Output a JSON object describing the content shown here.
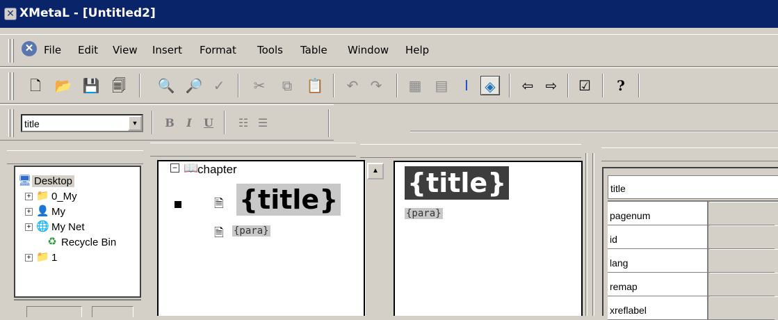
{
  "window": {
    "title": "XMetaL - [Untitled2]",
    "app_icon": "xmetal-logo-icon"
  },
  "menu": {
    "items": [
      "File",
      "Edit",
      "View",
      "Insert",
      "Format",
      "Tools",
      "Table",
      "Window",
      "Help"
    ]
  },
  "toolbar": {
    "buttons": [
      {
        "name": "new-document-icon",
        "glyph": "🗋"
      },
      {
        "name": "open-folder-icon",
        "glyph": "📂"
      },
      {
        "name": "save-icon",
        "glyph": "💾"
      },
      {
        "name": "save-all-icon",
        "glyph": "🗐"
      },
      {
        "name": "find-icon",
        "glyph": "🔍"
      },
      {
        "name": "find-replace-icon",
        "glyph": "🔎"
      },
      {
        "name": "spellcheck-icon",
        "glyph": "✓"
      },
      {
        "name": "cut-icon",
        "glyph": "✂"
      },
      {
        "name": "copy-icon",
        "glyph": "⧉"
      },
      {
        "name": "paste-icon",
        "glyph": "📋"
      },
      {
        "name": "undo-icon",
        "glyph": "↶"
      },
      {
        "name": "redo-icon",
        "glyph": "↷"
      },
      {
        "name": "insert-image-icon",
        "glyph": "▦"
      },
      {
        "name": "insert-table-icon",
        "glyph": "▤"
      },
      {
        "name": "text-cursor-icon",
        "glyph": "I"
      },
      {
        "name": "tags-on-view-icon",
        "glyph": "◈"
      },
      {
        "name": "back-arrow-icon",
        "glyph": "⇦"
      },
      {
        "name": "forward-arrow-icon",
        "glyph": "⇨"
      },
      {
        "name": "validate-icon",
        "glyph": "☑"
      },
      {
        "name": "help-icon",
        "glyph": "?"
      }
    ]
  },
  "format_bar": {
    "style_value": "title",
    "buttons": [
      {
        "name": "bold-icon",
        "glyph": "B"
      },
      {
        "name": "italic-icon",
        "glyph": "I"
      },
      {
        "name": "underline-icon",
        "glyph": "U"
      },
      {
        "name": "numbered-list-icon",
        "glyph": "☷"
      },
      {
        "name": "bulleted-list-icon",
        "glyph": "☰"
      }
    ]
  },
  "explorer": {
    "items": [
      {
        "label": "Desktop",
        "icon": "desktop-icon",
        "glyph": "🖥",
        "expandable": false
      },
      {
        "label": "0_My",
        "icon": "folder-icon",
        "glyph": "📁",
        "expandable": true
      },
      {
        "label": "My",
        "icon": "user-icon",
        "glyph": "👤",
        "expandable": true
      },
      {
        "label": "My Net",
        "icon": "network-icon",
        "glyph": "🌐",
        "expandable": true
      },
      {
        "label": "Recycle Bin",
        "icon": "recycle-bin-icon",
        "glyph": "♻",
        "expandable": false
      },
      {
        "label": "1",
        "icon": "folder-icon",
        "glyph": "📁",
        "expandable": true
      }
    ]
  },
  "structure": {
    "root": "chapter",
    "title_tag": "{title}",
    "para_tag": "{para}"
  },
  "tags_view": {
    "title_tag": "{title}",
    "para_tag": "{para}"
  },
  "attributes": {
    "element": "title",
    "rows": [
      "pagenum",
      "id",
      "lang",
      "remap",
      "xreflabel"
    ]
  }
}
